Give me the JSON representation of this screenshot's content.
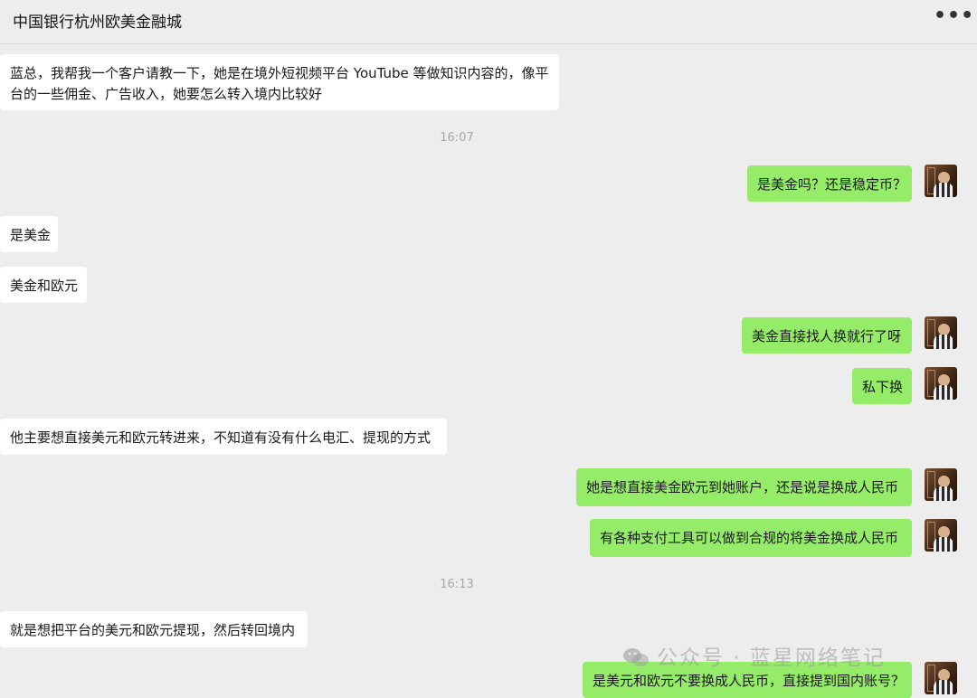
{
  "header": {
    "title": "中国银行杭州欧美金融城",
    "more_label": "•••"
  },
  "messages": [
    {
      "side": "in",
      "text": "蓝总，我帮我一个客户请教一下，她是在境外短视频平台 YouTube 等做知识内容的，像平台的一些佣金、广告收入，她要怎么转入境内比较好"
    },
    {
      "type": "time",
      "text": "16:07"
    },
    {
      "side": "out",
      "text": "是美金吗？还是稳定币？"
    },
    {
      "side": "in",
      "text": "是美金"
    },
    {
      "side": "in",
      "text": "美金和欧元"
    },
    {
      "side": "out",
      "text": "美金直接找人换就行了呀"
    },
    {
      "side": "out",
      "text": "私下换"
    },
    {
      "side": "in",
      "text": "他主要想直接美元和欧元转进来，不知道有没有什么电汇、提现的方式"
    },
    {
      "side": "out",
      "text": "她是想直接美金欧元到她账户，还是说是换成人民币"
    },
    {
      "side": "out",
      "text": "有各种支付工具可以做到合规的将美金换成人民币"
    },
    {
      "type": "time",
      "text": "16:13"
    },
    {
      "side": "in",
      "text": "就是想把平台的美元和欧元提现，然后转回境内"
    },
    {
      "side": "out",
      "text": "是美元和欧元不要换成人民币，直接提到国内账号？"
    }
  ],
  "watermark": {
    "text": "公众号 · 蓝星网络笔记"
  },
  "colors": {
    "background": "#ededed",
    "incoming_bubble": "#ffffff",
    "outgoing_bubble": "#95ec69",
    "timestamp": "#a8a8a8"
  }
}
